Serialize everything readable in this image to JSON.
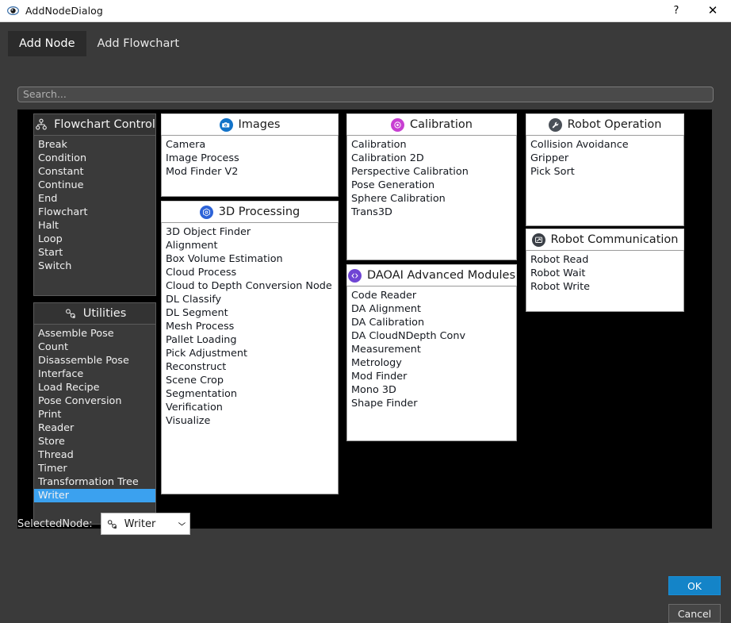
{
  "window": {
    "title": "AddNodeDialog",
    "icon": "app-eye-icon",
    "help_label": "?",
    "close_label": "✕"
  },
  "tabs": [
    {
      "label": "Add Node",
      "active": true
    },
    {
      "label": "Add Flowchart",
      "active": false
    }
  ],
  "search": {
    "placeholder": "Search...",
    "value": ""
  },
  "panels": [
    {
      "id": "flowchart-control",
      "title": "Flowchart Control",
      "icon": "hierarchy-icon",
      "theme": "dark",
      "items": [
        "Break",
        "Condition",
        "Constant",
        "Continue",
        "End",
        "Flowchart",
        "Halt",
        "Loop",
        "Start",
        "Switch"
      ],
      "selected": null
    },
    {
      "id": "utilities",
      "title": "Utilities",
      "icon": "link-chain-icon",
      "theme": "dark",
      "items": [
        "Assemble Pose",
        "Count",
        "Disassemble Pose",
        "Interface",
        "Load Recipe",
        "Pose Conversion",
        "Print",
        "Reader",
        "Store",
        "Thread",
        "Timer",
        "Transformation Tree",
        "Writer"
      ],
      "selected": "Writer"
    },
    {
      "id": "images",
      "title": "Images",
      "icon": "camera-icon",
      "icon_color": "#1273c9",
      "theme": "light",
      "items": [
        "Camera",
        "Image Process",
        "Mod Finder V2"
      ],
      "selected": null
    },
    {
      "id": "3d-processing",
      "title": "3D Processing",
      "icon": "cube-3d-icon",
      "icon_color": "#2d63d8",
      "theme": "light",
      "items": [
        "3D Object Finder",
        "Alignment",
        "Box Volume Estimation",
        "Cloud Process",
        "Cloud to Depth Conversion Node",
        "DL Classify",
        "DL Segment",
        "Mesh Process",
        "Pallet Loading",
        "Pick Adjustment",
        "Reconstruct",
        "Scene Crop",
        "Segmentation",
        "Verification",
        "Visualize"
      ],
      "selected": null
    },
    {
      "id": "calibration",
      "title": "Calibration",
      "icon": "target-icon",
      "icon_color": "#c83fd2",
      "theme": "light",
      "items": [
        "Calibration",
        "Calibration 2D",
        "Perspective Calibration",
        "Pose Generation",
        "Sphere Calibration",
        "Trans3D"
      ],
      "selected": null
    },
    {
      "id": "daoai-advanced-modules",
      "title": "DAOAI Advanced Modules",
      "icon": "code-brackets-icon",
      "icon_color": "#6f45d4",
      "theme": "light",
      "items": [
        "Code Reader",
        "DA Alignment",
        "DA Calibration",
        "DA CloudNDepth Conv",
        "Measurement",
        "Metrology",
        "Mod Finder",
        "Mono 3D",
        "Shape Finder"
      ],
      "selected": null
    },
    {
      "id": "robot-operation",
      "title": "Robot Operation",
      "icon": "wrench-icon",
      "icon_color": "#4a5058",
      "theme": "light",
      "items": [
        "Collision Avoidance",
        "Gripper",
        "Pick Sort"
      ],
      "selected": null
    },
    {
      "id": "robot-communication",
      "title": "Robot Communication",
      "icon": "terminal-screen-icon",
      "icon_color": "#3b4047",
      "theme": "light",
      "items": [
        "Robot Read",
        "Robot Wait",
        "Robot Write"
      ],
      "selected": null
    }
  ],
  "selected_node": {
    "label": "SelectedNode:",
    "value": "Writer",
    "icon": "link-chain-icon",
    "caret": "⌵"
  },
  "buttons": {
    "ok": "OK",
    "cancel": "Cancel"
  },
  "colors": {
    "accent": "#1484c8",
    "selection": "#3ba1ef",
    "canvas": "#000000",
    "dialog_bg": "#3a3a3a"
  }
}
